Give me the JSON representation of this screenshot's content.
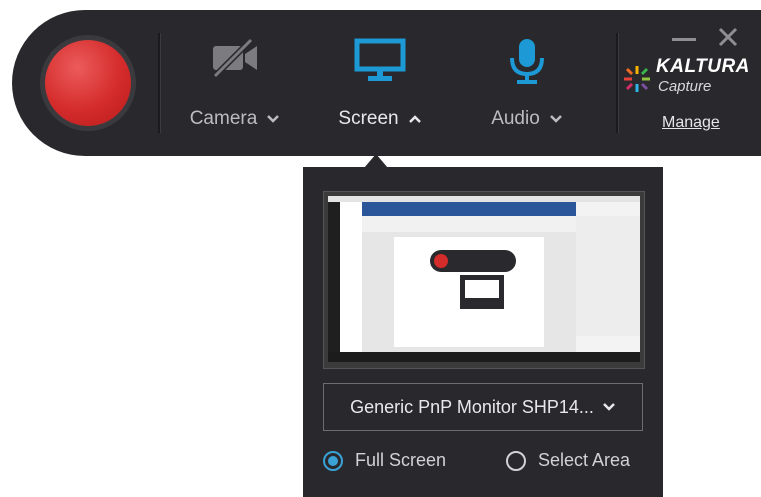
{
  "toolbar": {
    "record_button": "record",
    "sources": {
      "camera": {
        "label": "Camera",
        "icon": "camera-off-icon",
        "state": "collapsed"
      },
      "screen": {
        "label": "Screen",
        "icon": "monitor-icon",
        "state": "expanded"
      },
      "audio": {
        "label": "Audio",
        "icon": "microphone-icon",
        "state": "collapsed"
      }
    },
    "brand": {
      "name": "KALTURA",
      "subtitle": "Capture"
    },
    "manage_label": "Manage"
  },
  "screen_panel": {
    "monitor_selected": "Generic PnP Monitor SHP14...",
    "capture_modes": [
      {
        "label": "Full Screen",
        "selected": true
      },
      {
        "label": "Select Area",
        "selected": false
      }
    ]
  },
  "colors": {
    "bar_bg": "#29282c",
    "record_red": "#d42b2b",
    "accent_blue": "#1d9ad6",
    "radio_blue": "#3aa2d6"
  }
}
